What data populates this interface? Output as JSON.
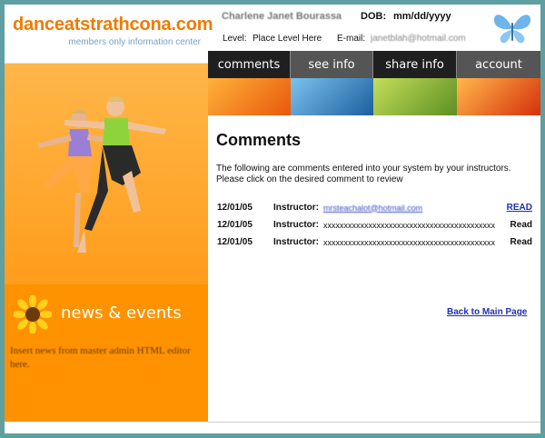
{
  "brand": {
    "title": "danceatstrathcona.com",
    "subtitle": "members only information center"
  },
  "header": {
    "member_name": "Charlene Janet Bourassa",
    "dob_label": "DOB:",
    "dob_value": "mm/dd/yyyy",
    "level_label": "Level:",
    "level_value": "Place Level Here",
    "email_label": "E-mail:",
    "email_value": "janetblah@hotmail.com"
  },
  "nav": [
    {
      "label": "comments",
      "bg": "#1f1f1f"
    },
    {
      "label": "see info",
      "bg": "#555555"
    },
    {
      "label": "share info",
      "bg": "#1f1f1f"
    },
    {
      "label": "account",
      "bg": "#555555"
    }
  ],
  "strip_colors": [
    "#f07a12",
    "#1f78b8",
    "#8ab83a",
    "#e84e12"
  ],
  "content": {
    "title": "Comments",
    "intro": "The following are comments entered into your system by your instructors. Please click on the desired comment to review"
  },
  "comments": [
    {
      "date": "12/01/05",
      "label": "Instructor:",
      "text": "mrsteachalot@hotmail.com",
      "action": "READ",
      "linked": true
    },
    {
      "date": "12/01/05",
      "label": "Instructor:",
      "text": "xxxxxxxxxxxxxxxxxxxxxxxxxxxxxxxxxxxxxxxxxx",
      "action": "Read",
      "linked": false
    },
    {
      "date": "12/01/05",
      "label": "Instructor:",
      "text": "xxxxxxxxxxxxxxxxxxxxxxxxxxxxxxxxxxxxxxxxxx",
      "action": "Read",
      "linked": false
    }
  ],
  "back_link": "Back to Main Page",
  "news": {
    "title": "news & events",
    "text": "Insert news from master admin HTML editor here."
  },
  "colors": {
    "page_bg": "#5f9fa2",
    "orange": "#ff9200",
    "link": "#1f2fb0"
  },
  "icons": {
    "butterfly": "butterfly-icon",
    "sunflower": "sunflower-icon"
  }
}
